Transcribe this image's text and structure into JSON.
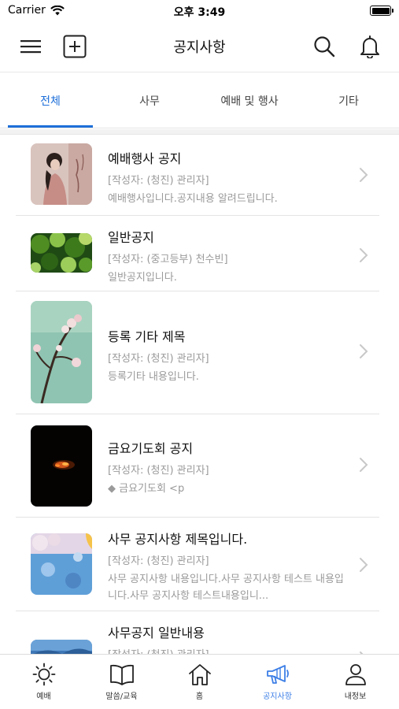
{
  "status_bar": {
    "carrier": "Carrier",
    "time": "오후 3:49"
  },
  "nav": {
    "title": "공지사항"
  },
  "tabs": [
    {
      "label": "전체",
      "selected": true
    },
    {
      "label": "사무",
      "selected": false
    },
    {
      "label": "예배 및 행사",
      "selected": false
    },
    {
      "label": "기타",
      "selected": false
    }
  ],
  "items": [
    {
      "title": "예배행사 공지",
      "author": "[작성자: (청진) 관리자]",
      "preview": "예배행사입니다.공지내용 알려드립니다.",
      "thumbnail": "woman-portrait-image"
    },
    {
      "title": "일반공지",
      "author": "[작성자: (중고등부) 천수빈]",
      "preview": "일반공지입니다.",
      "thumbnail": "green-leaves-image"
    },
    {
      "title": "등록 기타 제목",
      "author": "[작성자: (청진) 관리자]",
      "preview": "등록기타 내용입니다.",
      "thumbnail": "cherry-blossom-image"
    },
    {
      "title": "금요기도회 공지",
      "author": "[작성자: (청진) 관리자]",
      "preview": "◆ 금요기도회 <p",
      "thumbnail": "fire-dark-image"
    },
    {
      "title": "사무 공지사항 제목입니다.",
      "author": "[작성자: (청진) 관리자]",
      "preview": "사무 공지사항 내용입니다.사무 공지사항 테스트 내용입니다.사무 공지사항 테스트내용입니...",
      "thumbnail": "blue-blossom-image"
    },
    {
      "title": "사무공지 일반내용",
      "author": "[작성자: (청진) 관리자]",
      "preview": "",
      "thumbnail": "blue-landscape-image"
    }
  ],
  "tabbar": [
    {
      "label": "예배",
      "icon": "sun-icon",
      "active": false
    },
    {
      "label": "말씀/교육",
      "icon": "book-icon",
      "active": false
    },
    {
      "label": "홈",
      "icon": "home-icon",
      "active": false
    },
    {
      "label": "공지사항",
      "icon": "megaphone-icon",
      "active": true
    },
    {
      "label": "내정보",
      "icon": "person-icon",
      "active": false
    }
  ],
  "colors": {
    "accent": "#1e6fd9",
    "tabbar_active": "#3d7fe6",
    "secondary_text": "#9a9a9a"
  }
}
